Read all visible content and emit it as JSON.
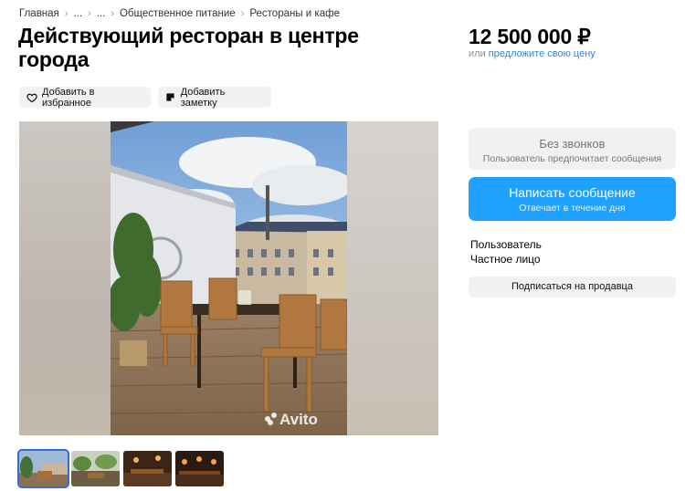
{
  "breadcrumb": {
    "items": [
      "Главная",
      "...",
      "...",
      "Общественное питание",
      "Рестораны и кафе"
    ],
    "separator": "›"
  },
  "listing": {
    "title": "Действующий ресторан в центре города"
  },
  "price": {
    "value": "12 500 000 ₽",
    "or": "или ",
    "offer_link": "предложите свою цену"
  },
  "actions": {
    "favorite_label": "Добавить в избранное",
    "note_label": "Добавить заметку"
  },
  "contact": {
    "no_calls_title": "Без звонков",
    "no_calls_sub": "Пользователь предпочитает сообщения",
    "write_title": "Написать сообщение",
    "write_sub": "Отвечает в течение дня"
  },
  "seller": {
    "name": "Пользователь",
    "type": "Частное лицо",
    "subscribe_label": "Подписаться на продавца"
  },
  "gallery": {
    "watermark": "Avito",
    "thumbnail_count": 4,
    "active_thumbnail": 1
  },
  "colors": {
    "accent": "#1ea1ff",
    "link": "#2d85e8",
    "chip_bg": "#f2f1f0"
  }
}
